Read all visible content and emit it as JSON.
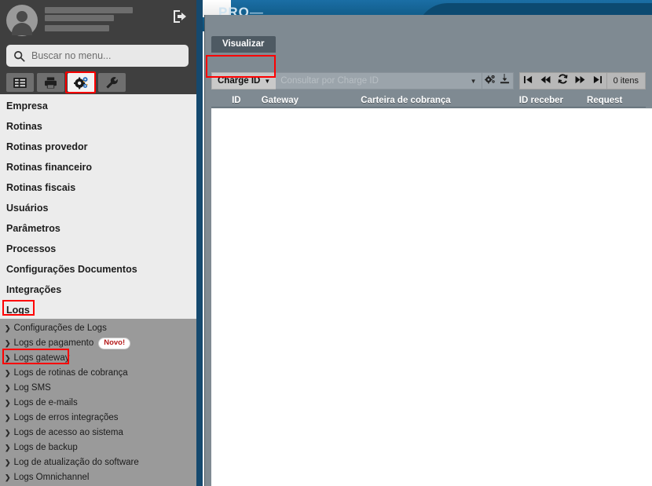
{
  "app": {
    "brand": "PRO",
    "brand_suffix": "—"
  },
  "sidebar": {
    "profile": {
      "avatar_icon": "user-avatar-icon",
      "name_redacted": true,
      "logout_icon": "logout-icon"
    },
    "search": {
      "placeholder": "Buscar no menu...",
      "value": "",
      "icon": "search-icon"
    },
    "icon_buttons": [
      {
        "name": "list-view-button",
        "icon": "list-icon",
        "active": false
      },
      {
        "name": "print-button",
        "icon": "printer-icon",
        "active": false
      },
      {
        "name": "settings-button",
        "icon": "gears-icon",
        "active": true,
        "highlighted": true
      },
      {
        "name": "tools-button",
        "icon": "wrench-icon",
        "active": false
      }
    ],
    "menu_items": [
      {
        "label": "Empresa"
      },
      {
        "label": "Rotinas"
      },
      {
        "label": "Rotinas provedor"
      },
      {
        "label": "Rotinas financeiro"
      },
      {
        "label": "Rotinas fiscais"
      },
      {
        "label": "Usuários"
      },
      {
        "label": "Parâmetros"
      },
      {
        "label": "Processos"
      },
      {
        "label": "Configurações Documentos"
      },
      {
        "label": "Integrações"
      },
      {
        "label": "Logs",
        "highlighted": true,
        "expanded": true
      }
    ],
    "submenu_items": [
      {
        "label": "Configurações de Logs"
      },
      {
        "label": "Logs de pagamento",
        "badge": "Novo!"
      },
      {
        "label": "Logs gateway",
        "highlighted": true
      },
      {
        "label": "Logs de rotinas de cobrança"
      },
      {
        "label": "Log SMS"
      },
      {
        "label": "Logs de e-mails"
      },
      {
        "label": "Logs de erros integrações"
      },
      {
        "label": "Logs de acesso ao sistema"
      },
      {
        "label": "Logs de backup"
      },
      {
        "label": "Log de atualização do software"
      },
      {
        "label": "Logs Omnichannel"
      }
    ]
  },
  "panel": {
    "tabs": [
      {
        "label": "Visualizar",
        "active": true
      }
    ],
    "toolbar": {
      "field_selector": "Charge ID",
      "field_caret_icon": "chevron-down-icon",
      "query_placeholder": "Consultar por Charge ID",
      "query_value": "",
      "query_caret_icon": "chevron-down-icon",
      "config_icon": "gears-icon",
      "export_icon": "download-icon",
      "pager": {
        "first_icon": "first-page-icon",
        "prev_icon": "previous-page-icon",
        "refresh_icon": "refresh-icon",
        "next_icon": "next-page-icon",
        "last_icon": "last-page-icon"
      },
      "items_count": "0 itens"
    },
    "table": {
      "columns": [
        {
          "label": "ID"
        },
        {
          "label": "Gateway"
        },
        {
          "label": "Carteira de cobrança"
        },
        {
          "label": "ID receber"
        },
        {
          "label": "Request"
        }
      ],
      "rows": []
    }
  },
  "colors": {
    "highlight_box": "#ff0000",
    "sidebar_bg": "#3f3f3f",
    "menu_bg": "#ececec",
    "submenu_bg": "#9a9a9a",
    "panel_bg": "#7f8a92",
    "accent_blue": "#15496e",
    "badge_text": "#b51b1b"
  }
}
